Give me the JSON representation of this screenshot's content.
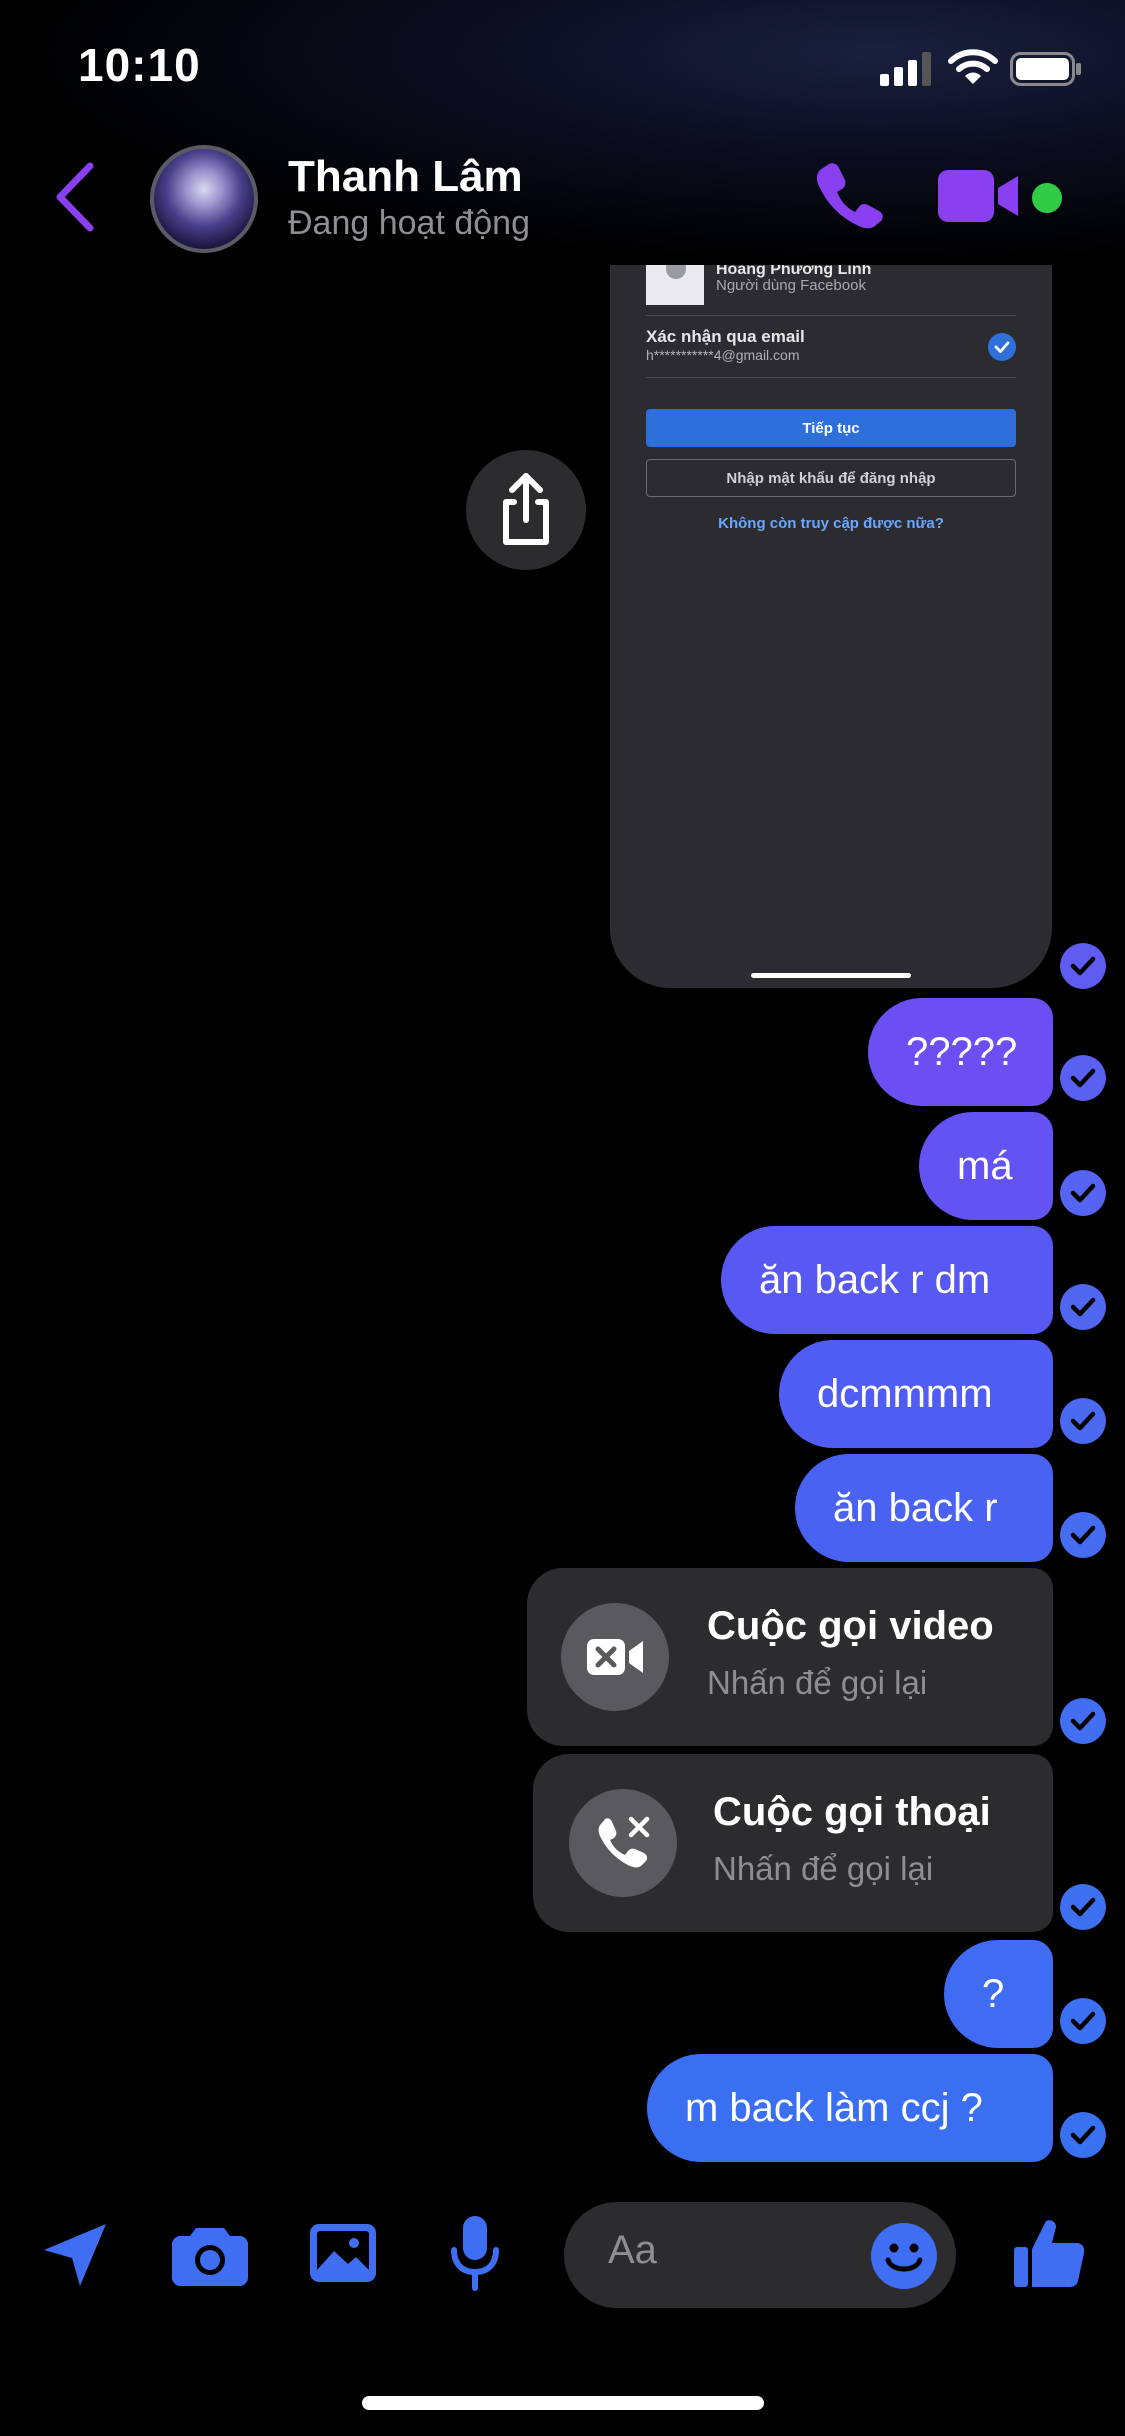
{
  "status_bar": {
    "time": "10:10"
  },
  "header": {
    "name": "Thanh Lâm",
    "status": "Đang hoạt động"
  },
  "screenshot_preview": {
    "account_name": "Hoàng Phương Linh",
    "account_type": "Người dùng Facebook",
    "confirm_title": "Xác nhận qua email",
    "masked_email": "h***********4@gmail.com",
    "continue_label": "Tiếp tục",
    "password_label": "Nhập mật khẩu để đăng nhập",
    "no_access_label": "Không còn truy cập được nữa?"
  },
  "messages": [
    {
      "text": "?????"
    },
    {
      "text": "má"
    },
    {
      "text": "ăn back r dm"
    },
    {
      "text": "dcmmmm"
    },
    {
      "text": "ăn back r"
    },
    {
      "title": "Cuộc gọi video",
      "subtitle": "Nhấn để gọi lại",
      "icon": "missed-video-icon"
    },
    {
      "title": "Cuộc gọi thoại",
      "subtitle": "Nhấn để gọi lại",
      "icon": "missed-call-icon"
    },
    {
      "text": "?"
    },
    {
      "text": "m back làm ccj ?"
    }
  ],
  "composer": {
    "placeholder": "Aa"
  },
  "colors": {
    "accent_purple": "#8a3ff0",
    "bubble_gradient_top": "#7a4cf2",
    "bubble_gradient_bottom": "#3a6cf0",
    "toolbar_blue": "#3f6ef2",
    "active_green": "#31cc46"
  }
}
